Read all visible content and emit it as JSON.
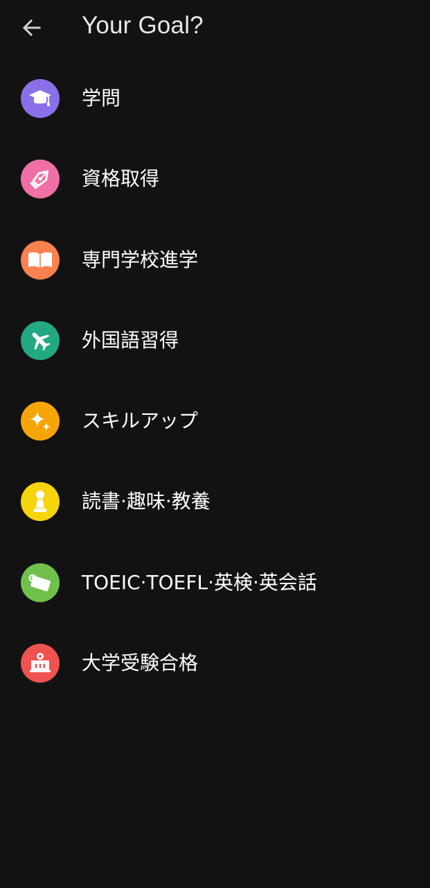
{
  "header": {
    "title": "Your Goal?",
    "back_icon": "arrow-left-icon"
  },
  "goals": [
    {
      "label": "学問",
      "icon": "graduation-cap-icon",
      "color": "#8b6fe8"
    },
    {
      "label": "資格取得",
      "icon": "pen-nib-icon",
      "color": "#f06fa5"
    },
    {
      "label": "専門学校進学",
      "icon": "open-book-icon",
      "color": "#fb8150"
    },
    {
      "label": "外国語習得",
      "icon": "airplane-icon",
      "color": "#22a882"
    },
    {
      "label": "スキルアップ",
      "icon": "sparkles-icon",
      "color": "#f6a509"
    },
    {
      "label": "読書·趣味·教養",
      "icon": "chess-pawn-icon",
      "color": "#f7d40b"
    },
    {
      "label": "TOEIC·TOEFL·英検·英会話",
      "icon": "name-tag-icon",
      "color": "#71c04c"
    },
    {
      "label": "大学受験合格",
      "icon": "school-building-icon",
      "color": "#ef5350"
    }
  ]
}
